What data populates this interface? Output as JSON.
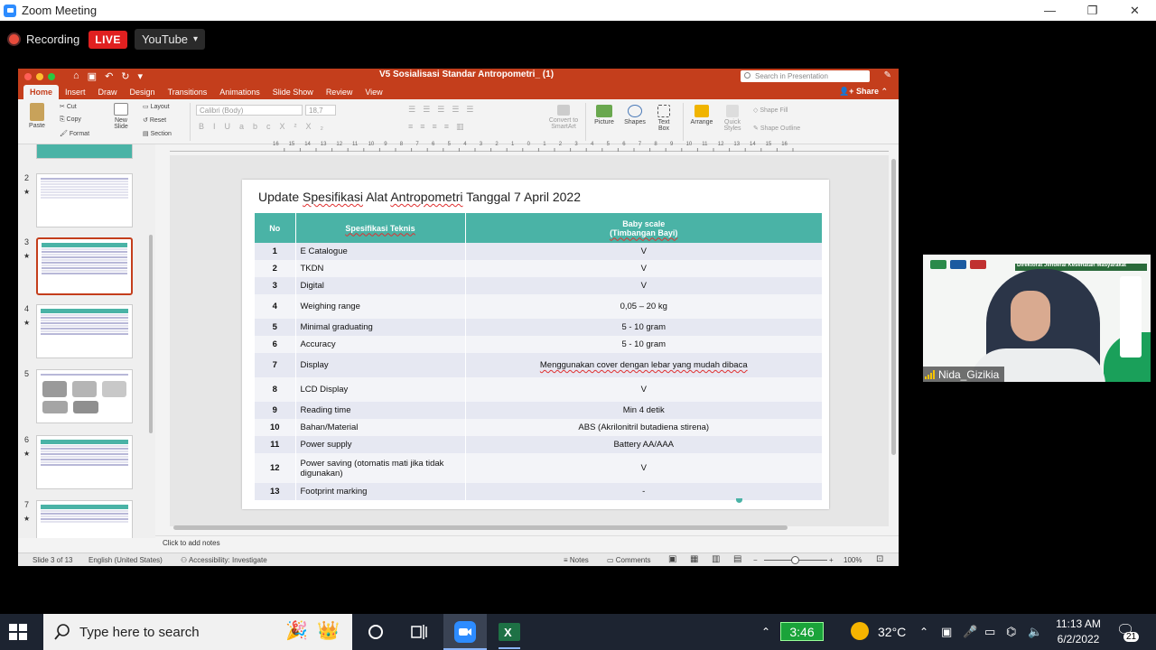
{
  "zoom": {
    "title": "Zoom Meeting",
    "window_controls": {
      "minimize": "—",
      "maximize": "❐",
      "close": "✕"
    },
    "recording_label": "Recording",
    "live_label": "LIVE",
    "stream_target": "YouTube",
    "stream_caret": "▾"
  },
  "ppt": {
    "filename": "V5 Sosialisasi Standar Antropometri_ (1)",
    "search_placeholder": "Search in Presentation",
    "share_label": "Share",
    "tabs": [
      "Home",
      "Insert",
      "Draw",
      "Design",
      "Transitions",
      "Animations",
      "Slide Show",
      "Review",
      "View"
    ],
    "ribbon": {
      "paste": "Paste",
      "cut": "Cut",
      "copy": "Copy",
      "format": "Format",
      "new_slide": "New Slide",
      "layout": "Layout",
      "reset": "Reset",
      "section": "Section",
      "font": "Calibri (Body)",
      "size": "18,7",
      "convert_smartart": "Convert to SmartArt",
      "picture": "Picture",
      "shapes": "Shapes",
      "text_box": "Text Box",
      "arrange": "Arrange",
      "quick_styles": "Quick Styles",
      "shape_fill": "Shape Fill",
      "shape_outline": "Shape Outline"
    },
    "ruler_labels": [
      "16",
      "15",
      "14",
      "13",
      "12",
      "11",
      "10",
      "9",
      "8",
      "7",
      "6",
      "5",
      "4",
      "3",
      "2",
      "1",
      "0",
      "1",
      "2",
      "3",
      "4",
      "5",
      "6",
      "7",
      "8",
      "9",
      "10",
      "11",
      "12",
      "13",
      "14",
      "15",
      "16"
    ],
    "thumbnails": [
      "2",
      "3",
      "4",
      "5",
      "6",
      "7"
    ],
    "notes_placeholder": "Click to add notes",
    "status": {
      "slide": "Slide 3 of 13",
      "language": "English (United States)",
      "accessibility": "Accessibility: Investigate",
      "notes": "Notes",
      "comments": "Comments",
      "zoom": "100%"
    }
  },
  "slide": {
    "title_pre": "Update ",
    "title_sq1": "Spesifikasi",
    "title_mid": " Alat ",
    "title_sq2": "Antropometri",
    "title_post": " Tanggal 7 April 2022",
    "headers": [
      "No",
      "Spesifikasi Teknis",
      "Baby scale",
      "(Timbangan Bayi)"
    ],
    "rows": [
      {
        "no": "1",
        "name": "E Catalogue",
        "val": "V"
      },
      {
        "no": "2",
        "name": "TKDN",
        "val": "V"
      },
      {
        "no": "3",
        "name": "Digital",
        "val": "V"
      },
      {
        "no": "4",
        "name": "Weighing range",
        "val": "0,05  – 20 kg"
      },
      {
        "no": "5",
        "name": "Minimal graduating",
        "val": "5 - 10 gram"
      },
      {
        "no": "6",
        "name": "Accuracy",
        "val": "5 - 10 gram"
      },
      {
        "no": "7",
        "name": "Display",
        "val": "Menggunakan cover dengan lebar yang mudah dibaca"
      },
      {
        "no": "8",
        "name": "LCD Display",
        "val": "V"
      },
      {
        "no": "9",
        "name": "Reading time",
        "val": "Min 4 detik"
      },
      {
        "no": "10",
        "name": "Bahan/Material",
        "val": "ABS (Akrilonitril butadiena stirena)"
      },
      {
        "no": "11",
        "name": "Power supply",
        "val": "Battery  AA/AAA"
      },
      {
        "no": "12",
        "name": "Power saving (otomatis mati jika tidak digunakan)",
        "val": "V"
      },
      {
        "no": "13",
        "name": "Footprint marking",
        "val": "-"
      }
    ]
  },
  "participant": {
    "name": "Nida_Gizikia",
    "banner": "Direktorat Jenderal Kesehatan Masyarakat"
  },
  "taskbar": {
    "search_placeholder": "Type here to search",
    "timer": "3:46",
    "weather": "32°C",
    "time": "11:13 AM",
    "date": "6/2/2022",
    "notifications": "21"
  }
}
